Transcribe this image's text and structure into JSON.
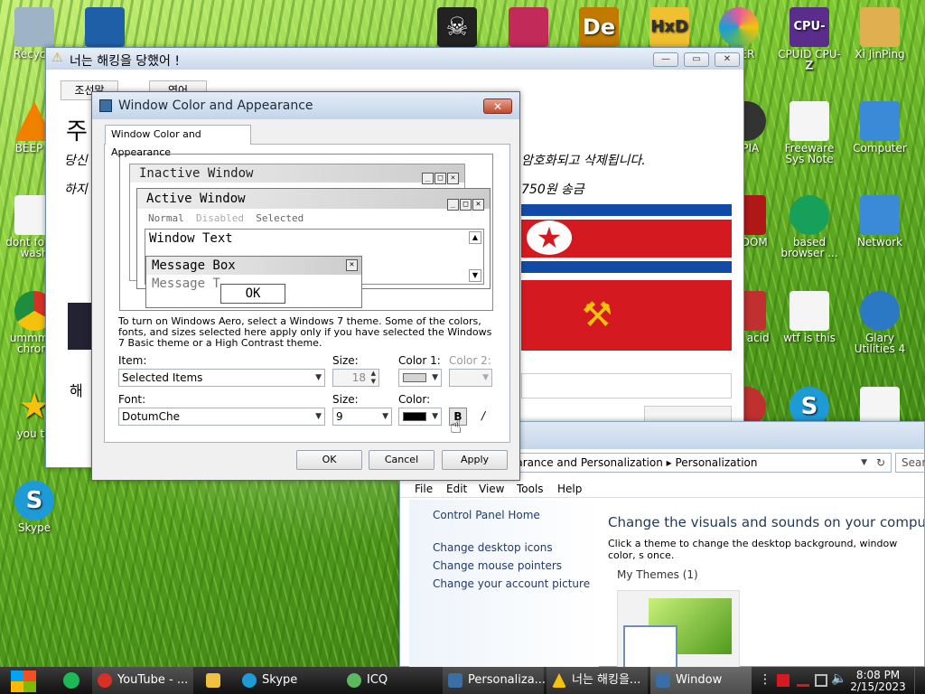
{
  "desktop": {
    "icons": [
      {
        "label": "Recycle",
        "color": "#9fb3c7"
      },
      {
        "label": "",
        "color": "#1f5fa8"
      },
      {
        "label": "",
        "color": "#222"
      },
      {
        "label": "",
        "color": "#c22a5a"
      },
      {
        "label": "",
        "color": "#c07a00"
      },
      {
        "label": "",
        "color": "#f0c030"
      },
      {
        "label": "",
        "color": "#e95a9a"
      },
      {
        "label": "CPUID CPU-Z",
        "color": "#5a2c8c"
      },
      {
        "label": "Xi JinPing",
        "color": "#e0b050"
      },
      {
        "label": "BEEP B",
        "color": "#f08000"
      },
      {
        "label": "OPIA",
        "color": "#333"
      },
      {
        "label": "Freeware Sys Note",
        "color": "#f5f5f5"
      },
      {
        "label": "Computer",
        "color": "#3a8ad8"
      },
      {
        "label": "dont for to wash",
        "color": "#f5f5f5"
      },
      {
        "label": "YA DOM",
        "color": "#b01818"
      },
      {
        "label": "based browser ...",
        "color": "#16a05a"
      },
      {
        "label": "Network",
        "color": "#3a8ad8"
      },
      {
        "label": "ummmm chrom",
        "color": "#d93025"
      },
      {
        "label": "dan acid",
        "color": "#c03030"
      },
      {
        "label": "wtf is this",
        "color": "#f5f5f5"
      },
      {
        "label": "Glary Utilities 4",
        "color": "#2b78c5"
      },
      {
        "label": "you tri",
        "color": "#f4c20d"
      },
      {
        "label": "",
        "color": "#c03030"
      },
      {
        "label": "",
        "color": "#1e9bd7"
      },
      {
        "label": "",
        "color": "#f5f5f5"
      },
      {
        "label": "Skype",
        "color": "#1e9bd7"
      },
      {
        "label": "P SER",
        "color": "#e95a9a"
      }
    ]
  },
  "ransom": {
    "title": "너는 해킹을 당했어 !",
    "tab1": "조선말",
    "tab2": "영어",
    "heading": "주",
    "line1": "당신",
    "line1b": "암호화되고 삭제됩니다.",
    "line2": "하지",
    "line2b": "750원 송금",
    "footer": "해"
  },
  "dialog": {
    "title": "Window Color and Appearance",
    "tab": "Window Color and Appearance",
    "preview": {
      "inactive": "Inactive Window",
      "active": "Active Window",
      "normal": "Normal",
      "disabled": "Disabled",
      "selected": "Selected",
      "window_text": "Window Text",
      "message_box": "Message Box",
      "message_text": "Message T",
      "ok": "OK"
    },
    "info": "To turn on Windows Aero, select a Windows 7 theme.  Some of the colors, fonts, and sizes selected here apply only if you have selected the Windows 7 Basic theme or a High Contrast theme.",
    "item_label": "Item:",
    "item_value": "Selected Items",
    "size_label": "Size:",
    "size_value": "18",
    "color1_label": "Color 1:",
    "color2_label": "Color 2:",
    "color1": "#d4d4d4",
    "font_label": "Font:",
    "font_value": "DotumChe",
    "fsize_label": "Size:",
    "fsize_value": "9",
    "color_label": "Color:",
    "font_color": "#000000",
    "bold": "B",
    "italic": "/",
    "ok": "OK",
    "cancel": "Cancel",
    "apply": "Apply"
  },
  "cp": {
    "breadcrumb1": "earance and Personalization",
    "breadcrumb2": "Personalization",
    "search": "Sear",
    "menu": [
      "File",
      "Edit",
      "View",
      "Tools",
      "Help"
    ],
    "home": "Control Panel Home",
    "links": [
      "Change desktop icons",
      "Change mouse pointers",
      "Change your account picture"
    ],
    "heading": "Change the visuals and sounds on your compute",
    "desc": "Click a theme to change the desktop background, window color, s once.",
    "my_themes": "My Themes (1)"
  },
  "taskbar": {
    "items": [
      {
        "label": "YouTube - ...",
        "color": "#d93025"
      },
      {
        "label": "",
        "color": "#f0c040"
      },
      {
        "label": "Skype",
        "color": "#1e9bd7"
      },
      {
        "label": "ICQ",
        "color": "#5cb85c"
      },
      {
        "label": "Personaliza...",
        "color": "#3a6ea5"
      },
      {
        "label": "너는 해킹을...",
        "color": "#f4c20d"
      },
      {
        "label": "Window Col...",
        "color": "#3a6ea5"
      }
    ],
    "time": "8:08 PM",
    "date": "2/15/2023"
  }
}
